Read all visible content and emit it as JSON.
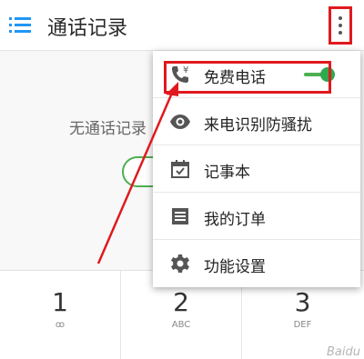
{
  "header": {
    "title": "通话记录",
    "menu_icon": "menu-list-icon",
    "overflow_icon": "more-vert-icon"
  },
  "empty_state": {
    "text": "无通话记录"
  },
  "menu": {
    "items": [
      {
        "label": "免费电话",
        "icon": "phone-yen-icon",
        "toggle_on": true
      },
      {
        "label": "来电识别防骚扰",
        "icon": "eye-icon"
      },
      {
        "label": "记事本",
        "icon": "calendar-check-icon"
      },
      {
        "label": "我的订单",
        "icon": "list-doc-icon"
      },
      {
        "label": "功能设置",
        "icon": "gear-icon"
      }
    ]
  },
  "keypad": {
    "keys": [
      {
        "digit": "1",
        "sub": "ꝏ"
      },
      {
        "digit": "2",
        "sub": "ABC"
      },
      {
        "digit": "3",
        "sub": "DEF"
      }
    ]
  },
  "colors": {
    "accent_blue": "#2196f3",
    "toggle_green": "#4cb050",
    "annotation_red": "#e0191e"
  }
}
